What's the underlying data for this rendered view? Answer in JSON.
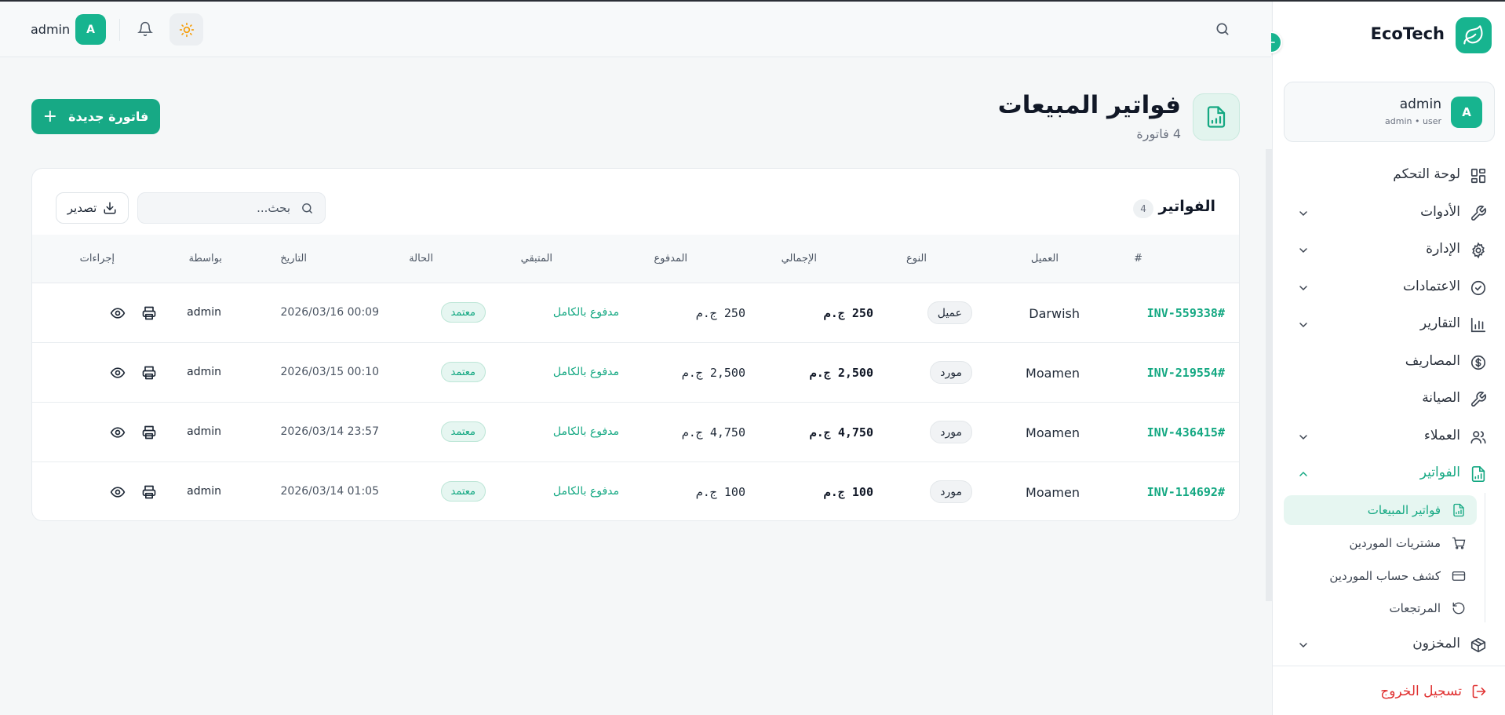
{
  "brand": "EcoTech",
  "colors": {
    "accent": "#17b48f",
    "danger": "#e03131"
  },
  "user": {
    "name": "admin",
    "role": "admin • user",
    "initial": "A"
  },
  "nav": {
    "dashboard": "لوحة التحكم",
    "tools": "الأدوات",
    "management": "الإدارة",
    "approvals": "الاعتمادات",
    "reports": "التقارير",
    "expenses": "المصاريف",
    "maintenance": "الصيانة",
    "clients": "العملاء",
    "invoices": "الفواتير",
    "inventory": "المخزون",
    "sub": {
      "sales_invoices": "فواتير المبيعات",
      "supplier_purchases": "مشتريات الموردين",
      "supplier_statement": "كشف حساب الموردين",
      "returns": "المرتجعات"
    },
    "logout": "تسجيل الخروج"
  },
  "topbar": {
    "user_label": "admin",
    "avatar_initial": "A"
  },
  "page": {
    "title": "فواتير المبيعات",
    "subtitle": "4 فاتورة",
    "new_button": "فاتورة جديدة"
  },
  "card": {
    "title": "الفواتير",
    "count": "4",
    "search_placeholder": "بحث...",
    "export_label": "تصدير"
  },
  "table": {
    "headers": {
      "num": "#",
      "client": "العميل",
      "type": "النوع",
      "total": "الإجمالي",
      "paid": "المدفوع",
      "remaining": "المتبقي",
      "status": "الحالة",
      "date": "التاريخ",
      "by": "بواسطة",
      "actions": "إجراءات"
    },
    "rows": [
      {
        "inv": "INV-559338#",
        "client": "Darwish",
        "type": "عميل",
        "total": "250 ج.م",
        "paid": "250 ج.م",
        "remaining": "مدفوع بالكامل",
        "status": "معتمد",
        "date": "2026/03/16 00:09",
        "by": "admin"
      },
      {
        "inv": "INV-219554#",
        "client": "Moamen",
        "type": "مورد",
        "total": "2,500 ج.م",
        "paid": "2,500 ج.م",
        "remaining": "مدفوع بالكامل",
        "status": "معتمد",
        "date": "2026/03/15 00:10",
        "by": "admin"
      },
      {
        "inv": "INV-436415#",
        "client": "Moamen",
        "type": "مورد",
        "total": "4,750 ج.م",
        "paid": "4,750 ج.م",
        "remaining": "مدفوع بالكامل",
        "status": "معتمد",
        "date": "2026/03/14 23:57",
        "by": "admin"
      },
      {
        "inv": "INV-114692#",
        "client": "Moamen",
        "type": "مورد",
        "total": "100 ج.م",
        "paid": "100 ج.م",
        "remaining": "مدفوع بالكامل",
        "status": "معتمد",
        "date": "2026/03/14 01:05",
        "by": "admin"
      }
    ]
  },
  "icons": {
    "brand": "leaf-icon",
    "collapse": "arrow-left-icon",
    "search": "search-icon",
    "bell": "bell-icon",
    "theme": "sun-icon",
    "page": "invoice-chart-icon",
    "new": "plus-icon",
    "export": "download-icon",
    "print": "printer-icon",
    "view": "eye-icon",
    "logout": "logout-icon"
  }
}
